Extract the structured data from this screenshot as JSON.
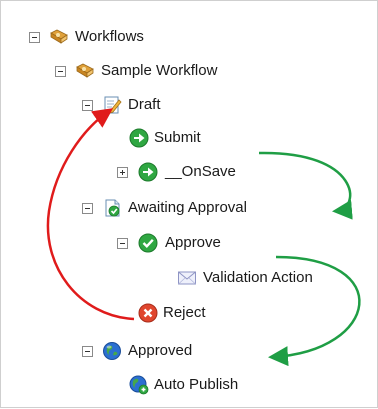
{
  "tree": {
    "root": {
      "label": "Workflows",
      "icon": "workflow-folder-icon"
    },
    "sample_workflow": {
      "label": "Sample Workflow",
      "icon": "workflow-folder-icon"
    },
    "draft": {
      "label": "Draft",
      "icon": "draft-state-icon"
    },
    "submit": {
      "label": "Submit",
      "icon": "green-arrow-action-icon"
    },
    "onsave": {
      "label": "__OnSave",
      "icon": "green-arrow-action-icon"
    },
    "awaiting_approval": {
      "label": "Awaiting Approval",
      "icon": "awaiting-approval-state-icon"
    },
    "approve": {
      "label": "Approve",
      "icon": "green-check-action-icon"
    },
    "validation_action": {
      "label": "Validation Action",
      "icon": "envelope-icon"
    },
    "reject": {
      "label": "Reject",
      "icon": "red-x-action-icon"
    },
    "approved": {
      "label": "Approved",
      "icon": "globe-state-icon"
    },
    "auto_publish": {
      "label": "Auto Publish",
      "icon": "globe-publish-icon"
    }
  },
  "annotations": {
    "forward_arrow_color": "#1f9e45",
    "backward_arrow_color": "#e01b1b"
  }
}
